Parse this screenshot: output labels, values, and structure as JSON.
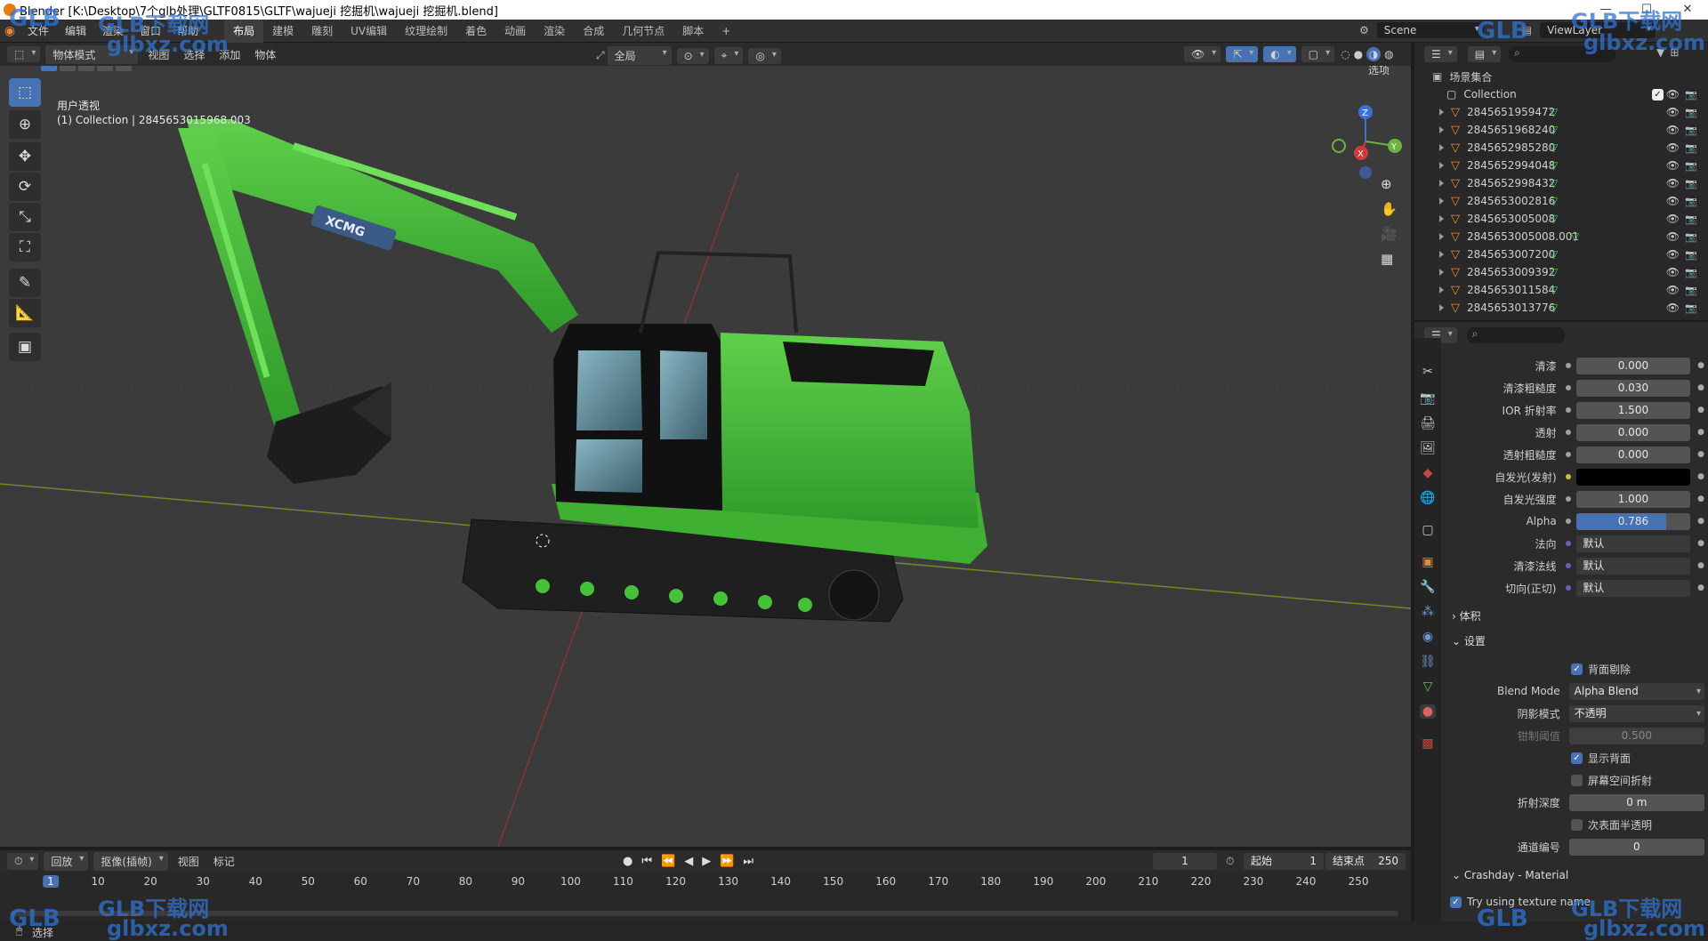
{
  "window": {
    "title": "Blender [K:\\Desktop\\7个glb处理\\GLTF0815\\GLTF\\wajueji 挖掘机\\wajueji 挖掘机.blend]"
  },
  "menus": [
    "文件",
    "编辑",
    "渲染",
    "窗口",
    "帮助"
  ],
  "workspace_tabs": [
    "布局",
    "建模",
    "雕刻",
    "UV编辑",
    "纹理绘制",
    "着色",
    "动画",
    "渲染",
    "合成",
    "几何节点",
    "脚本"
  ],
  "active_tab": "布局",
  "scene": "Scene",
  "view_layer": "ViewLayer",
  "viewport": {
    "mode": "物体模式",
    "menu": [
      "视图",
      "选择",
      "添加",
      "物体"
    ],
    "transform": "全局",
    "options": "选项",
    "view_name": "用户透视",
    "collection_info": "(1) Collection | 2845653015968.003",
    "gizmo_axes": [
      "Z",
      "Y",
      "X"
    ],
    "excavator_brand": "XCMG"
  },
  "outliner": {
    "root": "场景集合",
    "collection": "Collection",
    "objects": [
      "2845651959472",
      "2845651968240",
      "2845652985280",
      "2845652994048",
      "2845652998432",
      "2845653002816",
      "2845653005008",
      "2845653005008.001",
      "2845653007200",
      "2845653009392",
      "2845653011584",
      "2845653013776"
    ]
  },
  "properties": {
    "rows": [
      {
        "label": "清漆",
        "value": "0.000"
      },
      {
        "label": "清漆粗糙度",
        "value": "0.030"
      },
      {
        "label": "IOR 折射率",
        "value": "1.500"
      },
      {
        "label": "透射",
        "value": "0.000"
      },
      {
        "label": "透射粗糙度",
        "value": "0.000"
      },
      {
        "label": "自发光(发射)",
        "value": ""
      },
      {
        "label": "自发光强度",
        "value": "1.000"
      },
      {
        "label": "Alpha",
        "value": "0.786",
        "fraction": 0.786
      },
      {
        "label": "法向",
        "value": "默认"
      },
      {
        "label": "清漆法线",
        "value": "默认"
      },
      {
        "label": "切向(正切)",
        "value": "默认"
      }
    ],
    "section_volume": "体积",
    "section_settings": "设置",
    "backface_culling": "背面剔除",
    "blend_mode_label": "Blend Mode",
    "blend_mode_value": "Alpha Blend",
    "shadow_mode_label": "阴影模式",
    "shadow_mode_value": "不透明",
    "clip_threshold_label": "钳制阈值",
    "clip_threshold_value": "0.500",
    "show_backface": "显示背面",
    "screen_refraction": "屏幕空间折射",
    "refraction_depth_label": "折射深度",
    "refraction_depth_value": "0 m",
    "subsurface_translucency": "次表面半透明",
    "pass_index_label": "通道编号",
    "pass_index_value": "0",
    "section_crashday": "Crashday - Material",
    "try_texture": "Try using texture name"
  },
  "timeline": {
    "playback": "回放",
    "keying": "抠像(插帧)",
    "view": "视图",
    "marker": "标记",
    "current_frame": "1",
    "start_label": "起始",
    "start": "1",
    "end_label": "结束点",
    "end": "250",
    "ticks": [
      "1",
      "10",
      "20",
      "30",
      "40",
      "50",
      "60",
      "70",
      "80",
      "90",
      "100",
      "110",
      "120",
      "130",
      "140",
      "150",
      "160",
      "170",
      "180",
      "190",
      "200",
      "210",
      "220",
      "230",
      "240",
      "250"
    ]
  },
  "statusbar": {
    "select": "选择"
  },
  "watermark": {
    "brand": "GLB下载网",
    "url": "glbxz.com",
    "logo": "GLB"
  }
}
